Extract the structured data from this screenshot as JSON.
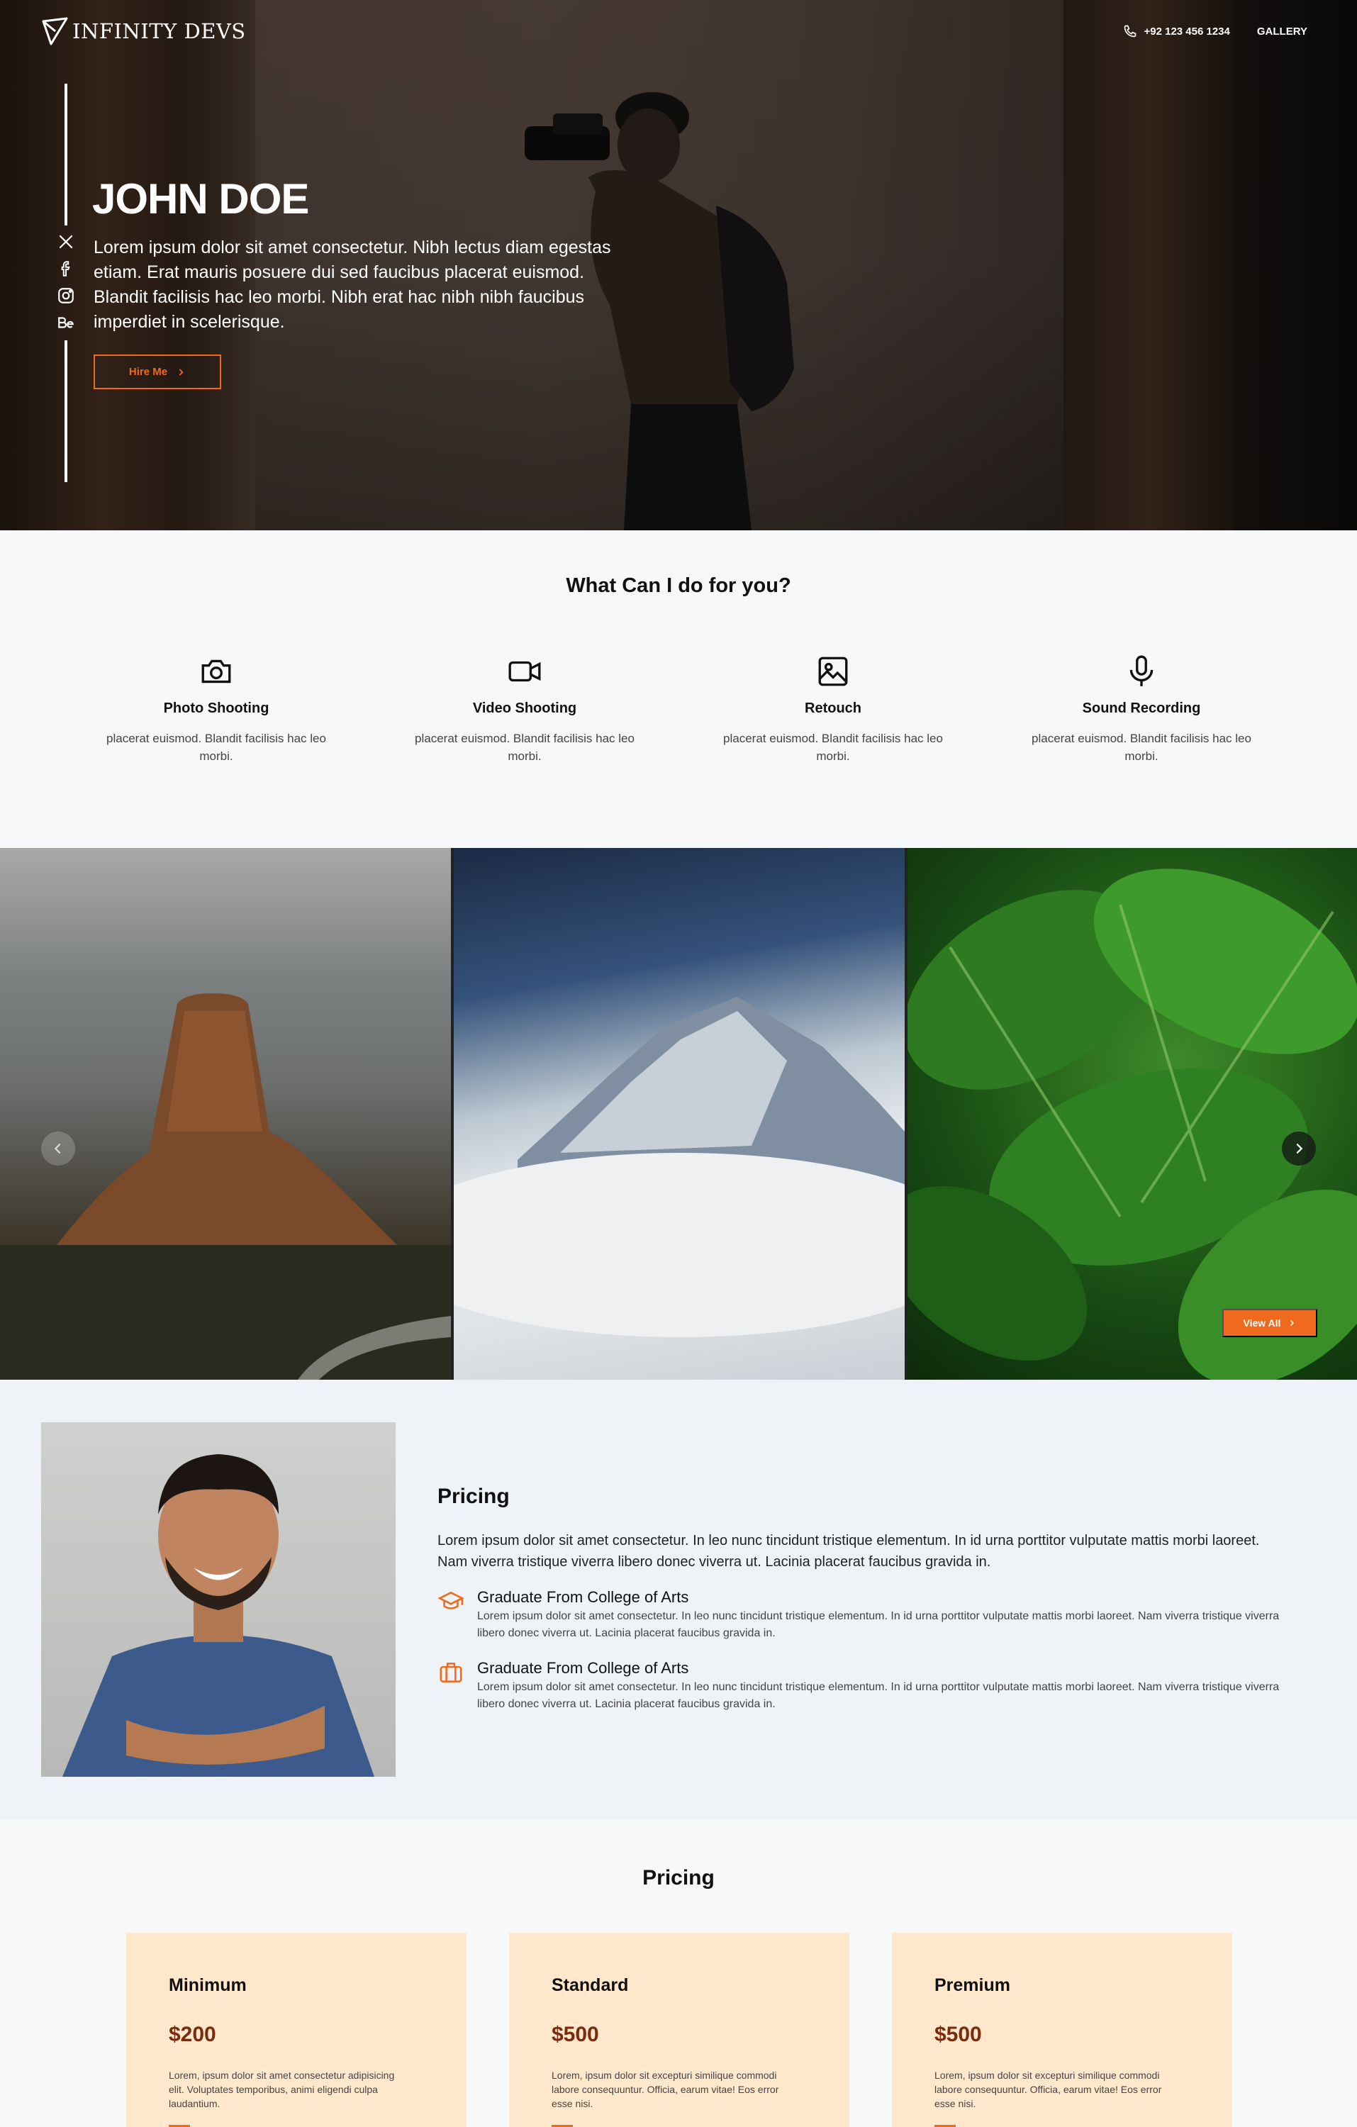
{
  "brand": {
    "name": "INFINITY DEVS"
  },
  "nav": {
    "phone": "+92 123 456 1234",
    "gallery": "GALLERY"
  },
  "socials": [
    "x-icon",
    "facebook-icon",
    "instagram-icon",
    "behance-icon"
  ],
  "hero": {
    "name": "JOHN DOE",
    "description": "Lorem ipsum dolor sit amet consectetur. Nibh lectus diam egestas etiam. Erat mauris posuere dui sed faucibus placerat euismod. Blandit facilisis hac leo morbi. Nibh erat hac nibh nibh faucibus imperdiet in scelerisque.",
    "cta": "Hire Me"
  },
  "services": {
    "title": "What Can I do for you?",
    "items": [
      {
        "icon": "camera-icon",
        "title": "Photo Shooting",
        "text": "placerat euismod. Blandit facilisis hac leo morbi."
      },
      {
        "icon": "video-icon",
        "title": "Video Shooting",
        "text": "placerat euismod. Blandit facilisis hac leo morbi."
      },
      {
        "icon": "image-icon",
        "title": "Retouch",
        "text": "placerat euismod. Blandit facilisis hac leo morbi."
      },
      {
        "icon": "microphone-icon",
        "title": "Sound Recording",
        "text": "placerat euismod. Blandit facilisis hac leo morbi."
      }
    ]
  },
  "gallery": {
    "view_all": "View All"
  },
  "about": {
    "title": "Pricing",
    "lead": "Lorem ipsum dolor sit amet consectetur. In leo nunc tincidunt tristique elementum. In id urna porttitor vulputate mattis morbi laoreet. Nam viverra tristique viverra libero donec viverra ut. Lacinia placerat faucibus gravida in.",
    "items": [
      {
        "icon": "graduation-cap-icon",
        "title": "Graduate From College of Arts",
        "text": "Lorem ipsum dolor sit amet consectetur. In leo nunc tincidunt tristique elementum. In id urna porttitor vulputate mattis morbi laoreet. Nam viverra tristique viverra libero donec viverra ut. Lacinia placerat faucibus gravida in."
      },
      {
        "icon": "briefcase-icon",
        "title": "Graduate From College of Arts",
        "text": "Lorem ipsum dolor sit amet consectetur. In leo nunc tincidunt tristique elementum. In id urna porttitor vulputate mattis morbi laoreet. Nam viverra tristique viverra libero donec viverra ut. Lacinia placerat faucibus gravida in."
      }
    ]
  },
  "pricing": {
    "title": "Pricing",
    "plans": [
      {
        "name": "Minimum",
        "price": "$200",
        "text": "Lorem, ipsum dolor sit amet consectetur adipisicing elit. Voluptates temporibus, animi eligendi culpa laudantium."
      },
      {
        "name": "Standard",
        "price": "$500",
        "text": "Lorem, ipsum dolor sit excepturi similique commodi labore consequuntur. Officia, earum vitae! Eos error esse nisi."
      },
      {
        "name": "Premium",
        "price": "$500",
        "text": "Lorem, ipsum dolor sit excepturi similique commodi labore consequuntur. Officia, earum vitae! Eos error esse nisi."
      }
    ]
  },
  "colors": {
    "accent": "#ef6a1c",
    "price": "#7b2a0c",
    "card": "#ffe8cc"
  }
}
